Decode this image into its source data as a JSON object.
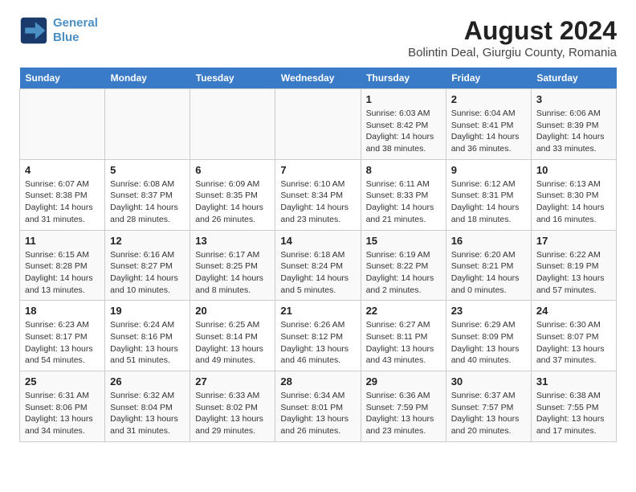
{
  "header": {
    "logo_line1": "General",
    "logo_line2": "Blue",
    "title": "August 2024",
    "subtitle": "Bolintin Deal, Giurgiu County, Romania"
  },
  "weekdays": [
    "Sunday",
    "Monday",
    "Tuesday",
    "Wednesday",
    "Thursday",
    "Friday",
    "Saturday"
  ],
  "weeks": [
    [
      {
        "day": "",
        "info": ""
      },
      {
        "day": "",
        "info": ""
      },
      {
        "day": "",
        "info": ""
      },
      {
        "day": "",
        "info": ""
      },
      {
        "day": "1",
        "info": "Sunrise: 6:03 AM\nSunset: 8:42 PM\nDaylight: 14 hours\nand 38 minutes."
      },
      {
        "day": "2",
        "info": "Sunrise: 6:04 AM\nSunset: 8:41 PM\nDaylight: 14 hours\nand 36 minutes."
      },
      {
        "day": "3",
        "info": "Sunrise: 6:06 AM\nSunset: 8:39 PM\nDaylight: 14 hours\nand 33 minutes."
      }
    ],
    [
      {
        "day": "4",
        "info": "Sunrise: 6:07 AM\nSunset: 8:38 PM\nDaylight: 14 hours\nand 31 minutes."
      },
      {
        "day": "5",
        "info": "Sunrise: 6:08 AM\nSunset: 8:37 PM\nDaylight: 14 hours\nand 28 minutes."
      },
      {
        "day": "6",
        "info": "Sunrise: 6:09 AM\nSunset: 8:35 PM\nDaylight: 14 hours\nand 26 minutes."
      },
      {
        "day": "7",
        "info": "Sunrise: 6:10 AM\nSunset: 8:34 PM\nDaylight: 14 hours\nand 23 minutes."
      },
      {
        "day": "8",
        "info": "Sunrise: 6:11 AM\nSunset: 8:33 PM\nDaylight: 14 hours\nand 21 minutes."
      },
      {
        "day": "9",
        "info": "Sunrise: 6:12 AM\nSunset: 8:31 PM\nDaylight: 14 hours\nand 18 minutes."
      },
      {
        "day": "10",
        "info": "Sunrise: 6:13 AM\nSunset: 8:30 PM\nDaylight: 14 hours\nand 16 minutes."
      }
    ],
    [
      {
        "day": "11",
        "info": "Sunrise: 6:15 AM\nSunset: 8:28 PM\nDaylight: 14 hours\nand 13 minutes."
      },
      {
        "day": "12",
        "info": "Sunrise: 6:16 AM\nSunset: 8:27 PM\nDaylight: 14 hours\nand 10 minutes."
      },
      {
        "day": "13",
        "info": "Sunrise: 6:17 AM\nSunset: 8:25 PM\nDaylight: 14 hours\nand 8 minutes."
      },
      {
        "day": "14",
        "info": "Sunrise: 6:18 AM\nSunset: 8:24 PM\nDaylight: 14 hours\nand 5 minutes."
      },
      {
        "day": "15",
        "info": "Sunrise: 6:19 AM\nSunset: 8:22 PM\nDaylight: 14 hours\nand 2 minutes."
      },
      {
        "day": "16",
        "info": "Sunrise: 6:20 AM\nSunset: 8:21 PM\nDaylight: 14 hours\nand 0 minutes."
      },
      {
        "day": "17",
        "info": "Sunrise: 6:22 AM\nSunset: 8:19 PM\nDaylight: 13 hours\nand 57 minutes."
      }
    ],
    [
      {
        "day": "18",
        "info": "Sunrise: 6:23 AM\nSunset: 8:17 PM\nDaylight: 13 hours\nand 54 minutes."
      },
      {
        "day": "19",
        "info": "Sunrise: 6:24 AM\nSunset: 8:16 PM\nDaylight: 13 hours\nand 51 minutes."
      },
      {
        "day": "20",
        "info": "Sunrise: 6:25 AM\nSunset: 8:14 PM\nDaylight: 13 hours\nand 49 minutes."
      },
      {
        "day": "21",
        "info": "Sunrise: 6:26 AM\nSunset: 8:12 PM\nDaylight: 13 hours\nand 46 minutes."
      },
      {
        "day": "22",
        "info": "Sunrise: 6:27 AM\nSunset: 8:11 PM\nDaylight: 13 hours\nand 43 minutes."
      },
      {
        "day": "23",
        "info": "Sunrise: 6:29 AM\nSunset: 8:09 PM\nDaylight: 13 hours\nand 40 minutes."
      },
      {
        "day": "24",
        "info": "Sunrise: 6:30 AM\nSunset: 8:07 PM\nDaylight: 13 hours\nand 37 minutes."
      }
    ],
    [
      {
        "day": "25",
        "info": "Sunrise: 6:31 AM\nSunset: 8:06 PM\nDaylight: 13 hours\nand 34 minutes."
      },
      {
        "day": "26",
        "info": "Sunrise: 6:32 AM\nSunset: 8:04 PM\nDaylight: 13 hours\nand 31 minutes."
      },
      {
        "day": "27",
        "info": "Sunrise: 6:33 AM\nSunset: 8:02 PM\nDaylight: 13 hours\nand 29 minutes."
      },
      {
        "day": "28",
        "info": "Sunrise: 6:34 AM\nSunset: 8:01 PM\nDaylight: 13 hours\nand 26 minutes."
      },
      {
        "day": "29",
        "info": "Sunrise: 6:36 AM\nSunset: 7:59 PM\nDaylight: 13 hours\nand 23 minutes."
      },
      {
        "day": "30",
        "info": "Sunrise: 6:37 AM\nSunset: 7:57 PM\nDaylight: 13 hours\nand 20 minutes."
      },
      {
        "day": "31",
        "info": "Sunrise: 6:38 AM\nSunset: 7:55 PM\nDaylight: 13 hours\nand 17 minutes."
      }
    ]
  ]
}
